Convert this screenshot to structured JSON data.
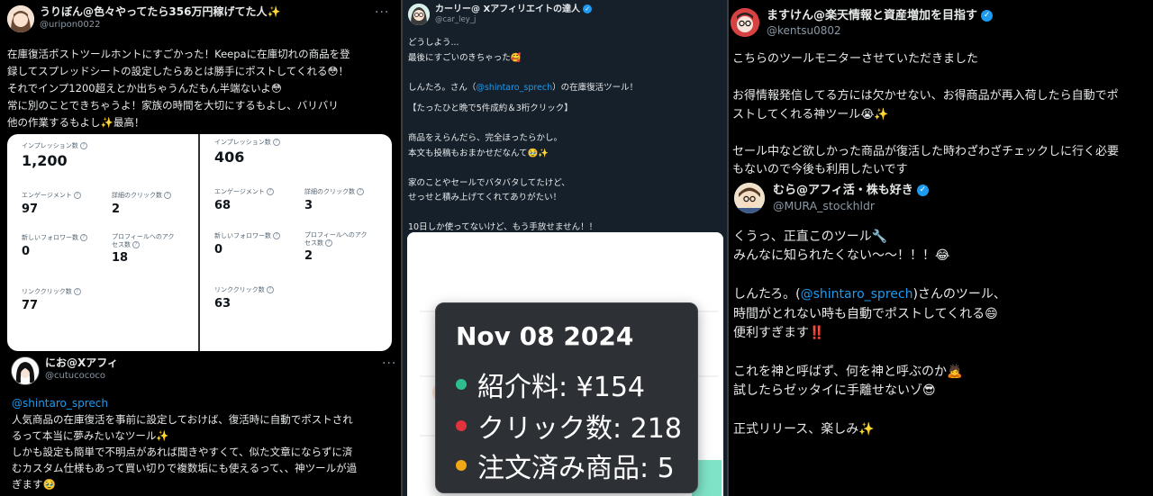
{
  "col1": {
    "post1": {
      "name": "うりぼん@色々やってたら356万円稼げてた人✨",
      "handle": "@uripon0022",
      "more": "···",
      "text": "在庫復活ポストツールホントにすごかった！Keepaに在庫切れの商品を登\n録してスプレッドシートの設定したらあとは勝手にポストしてくれる😳！\nそれでインプ1200超えとか出ちゃうんだもん半端ないよ😳\n常に別のことできちゃうよ！家族の時間を大切にするもよし、バリバリ\n他の作業するもよし✨最高！",
      "left_metrics": {
        "impressions_label": "インプレッション数",
        "impressions_value": "1,200",
        "engagement_label": "エンゲージメント",
        "engagement_value": "97",
        "detail_clicks_label": "詳細のクリック数",
        "detail_clicks_value": "2",
        "new_followers_label": "新しいフォロワー数",
        "new_followers_value": "0",
        "profile_access_label": "プロフィールへのアク\nセス数",
        "profile_access_value": "18",
        "link_clicks_label": "リンククリック数",
        "link_clicks_value": "77"
      },
      "right_metrics": {
        "impressions_label": "インプレッション数",
        "impressions_value": "406",
        "engagement_label": "エンゲージメント",
        "engagement_value": "68",
        "detail_clicks_label": "詳細のクリック数",
        "detail_clicks_value": "3",
        "new_followers_label": "新しいフォロワー数",
        "new_followers_value": "0",
        "profile_access_label": "プロフィールへのアク\nセス数",
        "profile_access_value": "2",
        "link_clicks_label": "リンククリック数",
        "link_clicks_value": "63"
      }
    },
    "post2": {
      "name": "にお@Xアフィ",
      "handle": "@cutucococo",
      "more": "···",
      "mention": "@shintaro_sprech",
      "text": "人気商品の在庫復活を事前に設定しておけば、復活時に自動でポストされ\nるって本当に夢みたいなツール✨\nしかも設定も簡単で不明点があれば聞きやすくて、似た文章にならずに済\nむカスタム仕様もあって買い切りで複数垢にも使えるって、、神ツールが過\nぎます🥹"
    }
  },
  "col2": {
    "name": "カーリー@ Xアフィリエイトの達人",
    "handle": "@car_ley_j",
    "text1": "どうしよう...\n最後にすごいのきちゃった🥰\n\nしんたろ。さん（",
    "mention": "@shintaro_sprech",
    "text2": "）の在庫復活ツール！",
    "text3": "【たったひと晩で5件成約＆3桁クリック】\n\n商品をえらんだら、完全ほったらかし。\n本文も投稿もおまかせだなんて🥹✨\n\n家のことやセールでバタバタしてたけど、\nせっせと積み上げてくれてありがたい！\n\n10日しか使ってないけど、もう手放せません！！",
    "tooltip": {
      "date": "Nov 08 2024",
      "row1": "紹介料: ¥154",
      "row2": "クリック数: 218",
      "row3": "注文済み商品: 5",
      "color1": "#2fbf8f",
      "color2": "#e0333b",
      "color3": "#f0a814"
    }
  },
  "col3": {
    "post1": {
      "name": "ますけん@楽天情報と資産増加を目指す",
      "handle": "@kentsu0802",
      "text": "こちらのツールモニターさせていただきました\n\nお得情報発信してる方には欠かせない、お得商品が再入荷したら自動でポ\nストしてくれる神ツール😭✨\n\nセール中など欲しかった商品が復活した時わざわざチェックしに行く必要\nもないので今後も利用したいです"
    },
    "post2": {
      "name": "むら@アフィ活・株も好き",
      "handle": "@MURA_stockhldr",
      "text1": "くうっ、正直このツール🔧\nみんなに知られたくない〜〜！！！😂\n\nしんたろ。(",
      "mention": "@shintaro_sprech",
      "text2": ")さんのツール、\n時間がとれない時も自動でポストしてくれる😄\n便利すぎます‼️\n\nこれを神と呼ばず、何を神と呼ぶのか🙇\n試したらゼッタイに手離せないゾ😎\n\n正式リリース、楽しみ✨"
    }
  }
}
